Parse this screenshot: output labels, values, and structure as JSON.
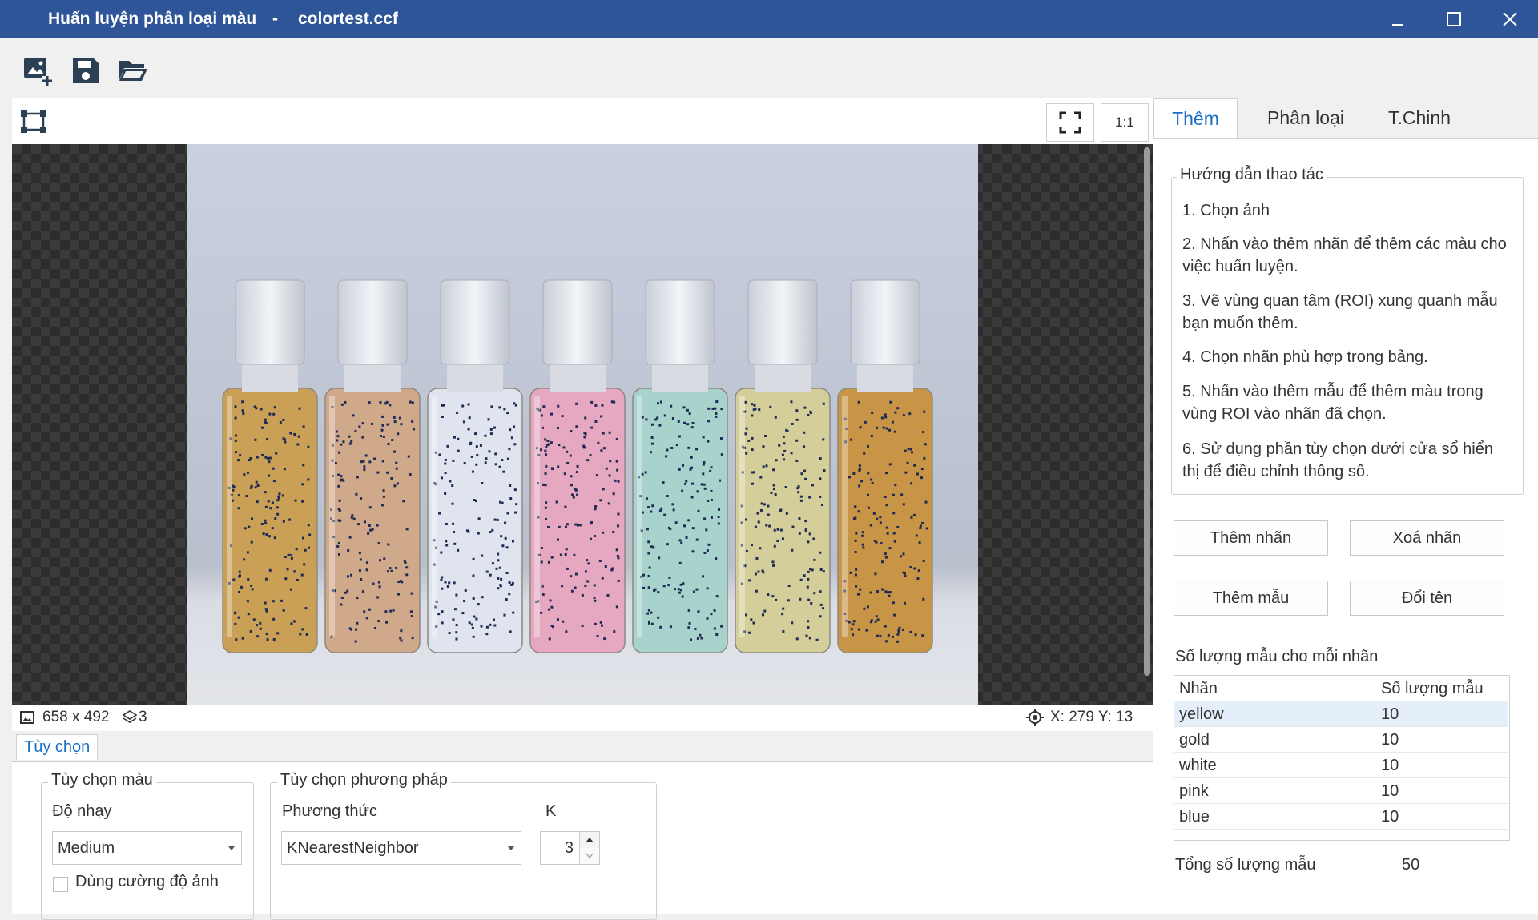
{
  "window": {
    "app_title": "Huấn luyện phân loại màu",
    "separator": "-",
    "file_name": "colortest.ccf"
  },
  "toolbar": {
    "icons": [
      "add-image-icon",
      "save-icon",
      "open-folder-icon"
    ]
  },
  "viewer": {
    "zoom_1_1_label": "1:1",
    "image_size": "658 x 492",
    "layer_count": "3",
    "cursor_position": "X: 279 Y: 13",
    "bottles": [
      {
        "liquid": "#c9a055",
        "cap": "#e6e8ee"
      },
      {
        "liquid": "#d0a88a",
        "cap": "#e6e8ee"
      },
      {
        "liquid": "#dfe4ee",
        "cap": "#e6e8ee"
      },
      {
        "liquid": "#e6a8c0",
        "cap": "#e6e8ee"
      },
      {
        "liquid": "#a8d3cc",
        "cap": "#e6e8ee"
      },
      {
        "liquid": "#d4cf9a",
        "cap": "#e6e8ee"
      },
      {
        "liquid": "#c89445",
        "cap": "#e6e8ee"
      }
    ]
  },
  "options": {
    "tab_label": "Tùy chọn",
    "color_group": {
      "title": "Tùy chọn màu",
      "sensitivity_label": "Độ nhạy",
      "sensitivity_value": "Medium",
      "intensity_checkbox_label": "Dùng cường độ ảnh"
    },
    "method_group": {
      "title": "Tùy chọn phương pháp",
      "method_label": "Phương thức",
      "method_value": "KNearestNeighbor",
      "k_label": "K",
      "k_value": "3"
    }
  },
  "right_panel": {
    "tabs": [
      "Thêm",
      "Phân loại",
      "T.Chinh"
    ],
    "active_tab": "Thêm",
    "guide": {
      "title": "Hướng dẫn thao tác",
      "steps": [
        "1. Chọn ảnh",
        "2. Nhấn vào thêm nhãn để thêm các màu cho việc huấn luyện.",
        "3. Vẽ vùng quan tâm (ROI) xung quanh mẫu bạn muốn thêm.",
        "4. Chọn nhãn phù hợp trong bảng.",
        "5. Nhấn vào thêm mẫu để thêm màu trong vùng ROI vào nhãn đã chọn.",
        "6. Sử dụng phần tùy chọn dưới cửa sổ hiển thị để điều chỉnh thông số."
      ]
    },
    "buttons": {
      "add_label": "Thêm nhãn",
      "delete_label": "Xoá nhãn",
      "add_sample": "Thêm mẫu",
      "rename": "Đổi tên"
    },
    "samples_title": "Số lượng mẫu cho mỗi nhãn",
    "table": {
      "columns": [
        "Nhãn",
        "Số lượng mẫu"
      ],
      "rows": [
        {
          "label": "yellow",
          "count": "10"
        },
        {
          "label": "gold",
          "count": "10"
        },
        {
          "label": "white",
          "count": "10"
        },
        {
          "label": "pink",
          "count": "10"
        },
        {
          "label": "blue",
          "count": "10"
        }
      ],
      "selected_row": 0
    },
    "total_label": "Tổng số lượng mẫu",
    "total_value": "50"
  },
  "colors": {
    "titlebar": "#2e5597",
    "accent": "#1a6fc4",
    "selected_row": "#e5eff9"
  }
}
